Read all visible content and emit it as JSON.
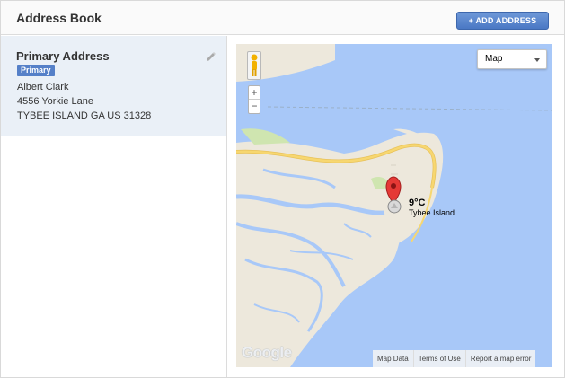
{
  "header": {
    "title": "Address Book",
    "add_button": "+ ADD ADDRESS"
  },
  "address": {
    "heading": "Primary Address",
    "badge": "Primary",
    "name": "Albert Clark",
    "street": "4556 Yorkie Lane",
    "city_line": "TYBEE ISLAND GA US 31328"
  },
  "map": {
    "type_label": "Map",
    "zoom_in": "+",
    "zoom_out": "−",
    "weather_temp": "9°C",
    "weather_place": "Tybee Island",
    "logo": "Google",
    "attributions": [
      "Map Data",
      "Terms of Use",
      "Report a map error"
    ]
  },
  "colors": {
    "accent": "#4a78c4",
    "badge": "#5580c8",
    "water": "#a8c8f8",
    "land": "#ede8dc",
    "road": "#f7d770",
    "marker": "#e53935"
  },
  "icons": [
    "pencil-icon",
    "pegman-icon",
    "map-marker-icon",
    "weather-icon",
    "caret-down-icon"
  ]
}
